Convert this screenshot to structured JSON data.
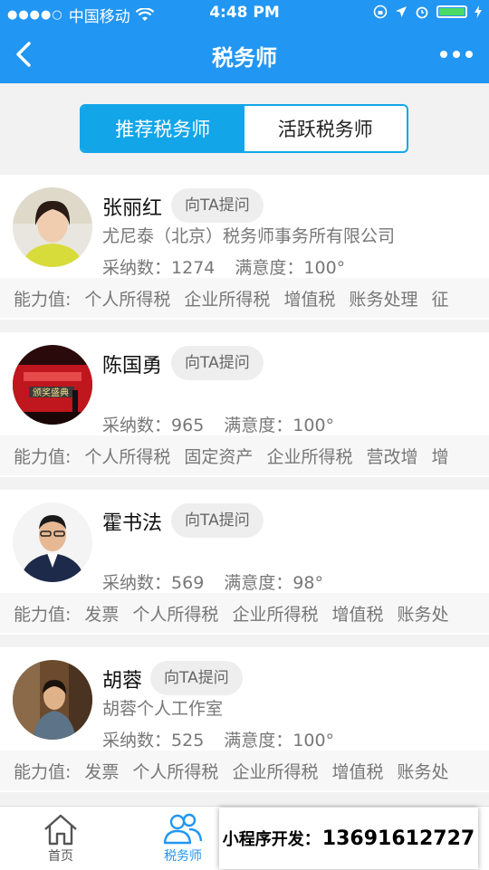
{
  "status": {
    "carrier": "中国移动",
    "time": "4:48 PM"
  },
  "nav": {
    "title": "税务师"
  },
  "tabs": [
    "推荐税务师",
    "活跃税务师"
  ],
  "ask_label": "向TA提问",
  "adopt_label": "采纳数：",
  "satisfaction_label": "满意度：",
  "ability_label": "能力值:",
  "advisors": [
    {
      "name": "张丽红",
      "company": "尤尼泰（北京）税务师事务所有限公司",
      "adopt": "1274",
      "satisfaction": "100°",
      "abilities": [
        "个人所得税",
        "企业所得税",
        "增值税",
        "账务处理",
        "征"
      ]
    },
    {
      "name": "陈国勇",
      "company": "",
      "adopt": "965",
      "satisfaction": "100°",
      "abilities": [
        "个人所得税",
        "固定资产",
        "企业所得税",
        "营改增",
        "增"
      ]
    },
    {
      "name": "霍书法",
      "company": "",
      "adopt": "569",
      "satisfaction": "98°",
      "abilities": [
        "发票",
        "个人所得税",
        "企业所得税",
        "增值税",
        "账务处"
      ]
    },
    {
      "name": "胡蓉",
      "company": "胡蓉个人工作室",
      "adopt": "525",
      "satisfaction": "100°",
      "abilities": [
        "发票",
        "个人所得税",
        "企业所得税",
        "增值税",
        "账务处"
      ]
    }
  ],
  "tabbar": {
    "home": "首页",
    "advisors": "税务师"
  },
  "promo": {
    "label": "小程序开发：",
    "phone": "13691612727"
  },
  "colors": {
    "primary": "#2196f3",
    "segment": "#12a6e8"
  }
}
